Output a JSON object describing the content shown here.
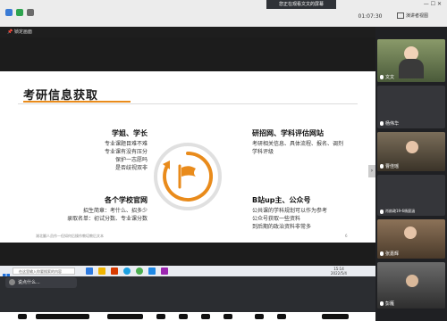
{
  "meeting": {
    "share_banner": "您正在观看文文的屏幕",
    "timer": "01:07:30",
    "layout_label": "演讲者视图",
    "pin_label": "锁定画面"
  },
  "slide": {
    "title": "考研信息获取",
    "sections": [
      {
        "title": "学姐、学长",
        "lines": [
          "专业课题目难不难",
          "专业课有没有压分",
          "保护一志愿吗",
          "是否歧视双非"
        ]
      },
      {
        "title": "研招网、学科评估网站",
        "lines": [
          "考研相关信息、具体流程、报名、调剂",
          "学科评级"
        ]
      },
      {
        "title": "各个学校官网",
        "lines": [
          "招生简章：考什么、招多少",
          "录取名单：初试分数、专业课分数"
        ]
      },
      {
        "title": "B站up主、公众号",
        "lines": [
          "公共课的学科规划可以作为参考",
          "公众号获取一些资料",
          "到后期的政治资料非常多"
        ]
      }
    ],
    "footer": "湖北翻人员作—但如何后操作教培教后文本",
    "page": "6"
  },
  "taskbar": {
    "search_placeholder": "在这里输入你要搜索的内容",
    "time": "15:14",
    "date": "2022/5/4"
  },
  "chat_popup": "说点什么...",
  "participants": [
    {
      "name": "文文"
    },
    {
      "name": "杨伟华"
    },
    {
      "name": "曹佳瑶"
    },
    {
      "name": "肖韵政19-6杨宸涵"
    },
    {
      "name": "张嘉辉"
    },
    {
      "name": "彭雁"
    }
  ],
  "colors": {
    "accent": "#e98b1b",
    "dark": "#1c1c1c"
  }
}
